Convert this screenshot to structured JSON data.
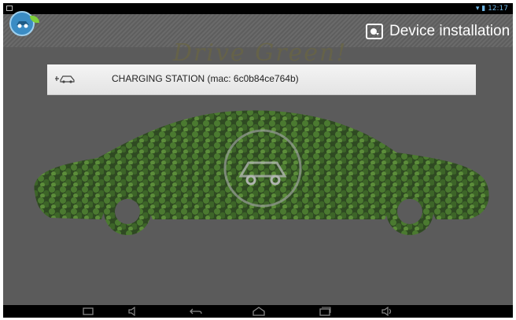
{
  "status_bar": {
    "time": "12:17"
  },
  "action_bar": {
    "title": "Device installation",
    "app_icon": "app-logo-icon",
    "action_icon": "installer-icon"
  },
  "background": {
    "text": "Drive Green!"
  },
  "device_list": [
    {
      "label": "CHARGING STATION (mac: 6c0b84ce764b)",
      "icon": "car-plug-icon"
    }
  ],
  "nav_bar": {
    "buttons": [
      "screenshot-icon",
      "volume-down-icon",
      "back-icon",
      "home-icon",
      "recent-apps-icon",
      "volume-up-icon"
    ]
  },
  "colors": {
    "accent_text": "#ffffff",
    "row_background": "#eeeeee",
    "statusbar_icons": "#6fb8e8"
  }
}
